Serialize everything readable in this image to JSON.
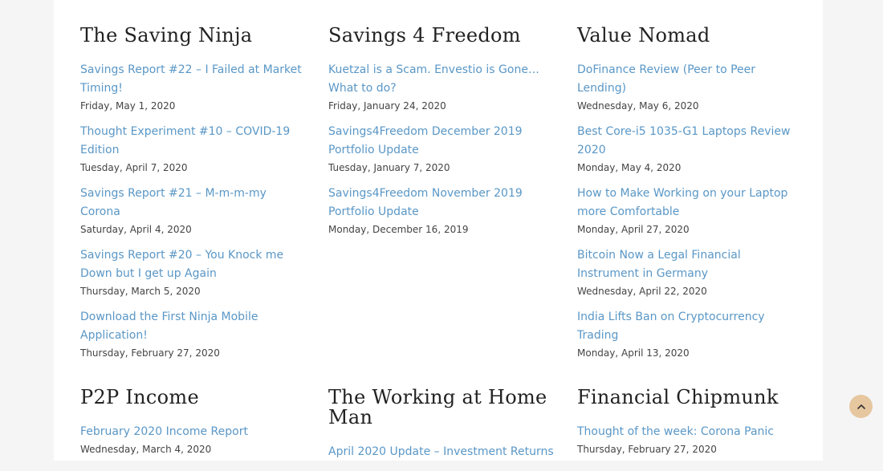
{
  "widgets": [
    {
      "title": "The Saving Ninja",
      "posts": [
        {
          "title": "Savings Report #22 – I Failed at Market Timing!",
          "date": "Friday, May 1, 2020"
        },
        {
          "title": "Thought Experiment #10 – COVID-19 Edition",
          "date": "Tuesday, April 7, 2020"
        },
        {
          "title": "Savings Report #21 – M-m-m-my Corona",
          "date": "Saturday, April 4, 2020"
        },
        {
          "title": "Savings Report #20 – You Knock me Down but I get up Again",
          "date": "Thursday, March 5, 2020"
        },
        {
          "title": "Download the First Ninja Mobile Application!",
          "date": "Thursday, February 27, 2020"
        }
      ]
    },
    {
      "title": "Savings 4 Freedom",
      "posts": [
        {
          "title": "Kuetzal is a Scam. Envestio is Gone… What to do?",
          "date": "Friday, January 24, 2020"
        },
        {
          "title": "Savings4Freedom December 2019 Portfolio Update",
          "date": "Tuesday, January 7, 2020"
        },
        {
          "title": "Savings4Freedom November 2019 Portfolio Update",
          "date": "Monday, December 16, 2019"
        }
      ]
    },
    {
      "title": "Value Nomad",
      "posts": [
        {
          "title": "DoFinance Review (Peer to Peer Lending)",
          "date": "Wednesday, May 6, 2020"
        },
        {
          "title": "Best Core-i5 1035-G1 Laptops Review 2020",
          "date": "Monday, May 4, 2020"
        },
        {
          "title": "How to Make Working on your Laptop more Comfortable",
          "date": "Monday, April 27, 2020"
        },
        {
          "title": "Bitcoin Now a Legal Financial Instrument in Germany",
          "date": "Wednesday, April 22, 2020"
        },
        {
          "title": "India Lifts Ban on Cryptocurrency Trading",
          "date": "Monday, April 13, 2020"
        }
      ]
    },
    {
      "title": "P2P Income",
      "posts": [
        {
          "title": "February 2020 Income Report",
          "date": "Wednesday, March 4, 2020"
        }
      ]
    },
    {
      "title": "The Working at Home Man",
      "posts": [
        {
          "title": "April 2020 Update – Investment Returns",
          "date": ""
        }
      ]
    },
    {
      "title": "Financial Chipmunk",
      "posts": [
        {
          "title": "Thought of the week: Corona Panic",
          "date": "Thursday, February 27, 2020"
        }
      ]
    }
  ],
  "colors": {
    "link": "#5a97c6",
    "scroll_top_button": "#e6c7a0"
  },
  "scroll_top": {
    "icon": "chevron-up-icon"
  }
}
